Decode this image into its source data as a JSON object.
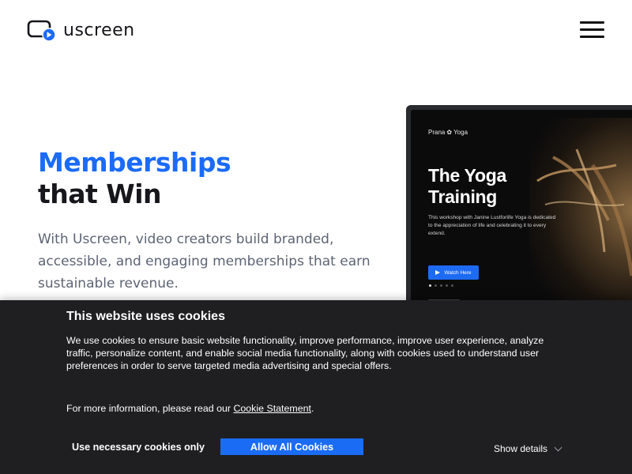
{
  "header": {
    "logo_text": "uscreen",
    "logo_icon": "tv-play-icon",
    "menu_icon": "hamburger-menu-icon"
  },
  "hero": {
    "title_line1": "Memberships",
    "title_line2": "that Win",
    "description": "With Uscreen, video creators build branded, accessible, and engaging memberships that earn sustainable revenue.",
    "accent_color": "#1b6bf7"
  },
  "mockup": {
    "brand_left": "Prana",
    "brand_right": "Yoga",
    "title_line1": "The Yoga",
    "title_line2": "Training",
    "description": "This workshop with Janine Lustforlife Yoga is dedicated to the appreciation of life and celebrating it to every extend.",
    "watch_button": "Watch Here"
  },
  "cookie_banner": {
    "title": "This website uses cookies",
    "body": "We use cookies to ensure basic website functionality, improve performance, improve user experience, analyze traffic, personalize content, and enable social media functionality, along with cookies used to understand user preferences in order to serve targeted media advertising and special offers.",
    "more_prefix": "For more information, please read our ",
    "more_link": "Cookie Statement",
    "more_suffix": ".",
    "necessary_button": "Use necessary cookies only",
    "allow_button": "Allow All Cookies",
    "show_details": "Show details",
    "allow_color": "#1a6cf5",
    "background_color": "#1f1f22"
  }
}
